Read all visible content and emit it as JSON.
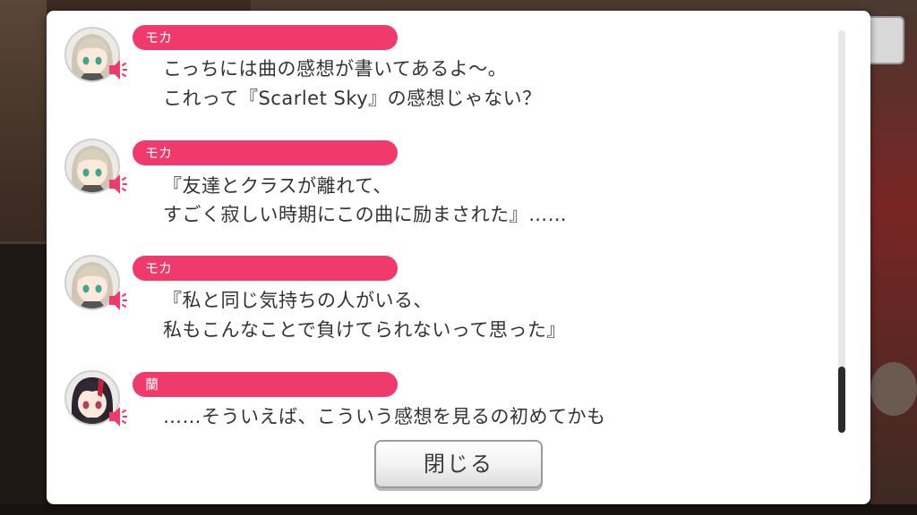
{
  "log": {
    "entries": [
      {
        "speaker": "モカ",
        "lines": [
          "こっちには曲の感想が書いてあるよ〜。",
          "これって『Scarlet Sky』の感想じゃない？"
        ]
      },
      {
        "speaker": "モカ",
        "lines": [
          "『友達とクラスが離れて、",
          "すごく寂しい時期にこの曲に励まされた』……"
        ]
      },
      {
        "speaker": "モカ",
        "lines": [
          "『私と同じ気持ちの人がいる、",
          "私もこんなことで負けてられないって思った』"
        ]
      },
      {
        "speaker": "蘭",
        "lines": [
          "……そういえば、こういう感想を見るの初めてかも"
        ]
      }
    ]
  },
  "close_button": {
    "label": "閉じる"
  },
  "colors": {
    "name_tag": "#ef3a6b",
    "speaker_icon": "#ef3a6b",
    "scroll_thumb": "#2a2a2a"
  }
}
